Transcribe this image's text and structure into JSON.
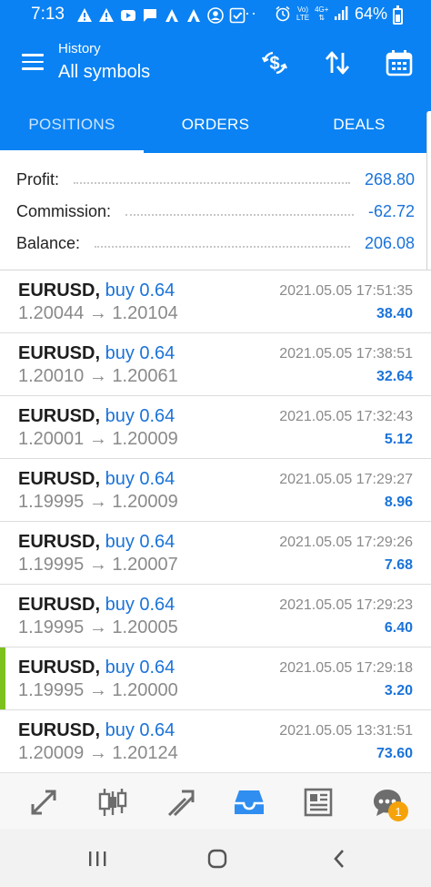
{
  "status_bar": {
    "time": "7:13",
    "dots": "···",
    "network_top": "Vo)",
    "network_bottom": "LTE",
    "network2_top": "4G+",
    "battery": "64%"
  },
  "app_bar": {
    "subtitle": "History",
    "title": "All symbols"
  },
  "tabs": [
    {
      "label": "POSITIONS",
      "active": true
    },
    {
      "label": "ORDERS",
      "active": false
    },
    {
      "label": "DEALS",
      "active": false
    }
  ],
  "summary": {
    "profit_label": "Profit:",
    "profit_value": "268.80",
    "commission_label": "Commission:",
    "commission_value": "-62.72",
    "balance_label": "Balance:",
    "balance_value": "206.08"
  },
  "deals": [
    {
      "symbol": "EURUSD,",
      "type": "buy 0.64",
      "prices": "1.20044 → 1.20104",
      "time": "2021.05.05 17:51:35",
      "profit": "38.40",
      "marked": false
    },
    {
      "symbol": "EURUSD,",
      "type": "buy 0.64",
      "prices": "1.20010 → 1.20061",
      "time": "2021.05.05 17:38:51",
      "profit": "32.64",
      "marked": false
    },
    {
      "symbol": "EURUSD,",
      "type": "buy 0.64",
      "prices": "1.20001 → 1.20009",
      "time": "2021.05.05 17:32:43",
      "profit": "5.12",
      "marked": false
    },
    {
      "symbol": "EURUSD,",
      "type": "buy 0.64",
      "prices": "1.19995 → 1.20009",
      "time": "2021.05.05 17:29:27",
      "profit": "8.96",
      "marked": false
    },
    {
      "symbol": "EURUSD,",
      "type": "buy 0.64",
      "prices": "1.19995 → 1.20007",
      "time": "2021.05.05 17:29:26",
      "profit": "7.68",
      "marked": false
    },
    {
      "symbol": "EURUSD,",
      "type": "buy 0.64",
      "prices": "1.19995 → 1.20005",
      "time": "2021.05.05 17:29:23",
      "profit": "6.40",
      "marked": false
    },
    {
      "symbol": "EURUSD,",
      "type": "buy 0.64",
      "prices": "1.19995 → 1.20000",
      "time": "2021.05.05 17:29:18",
      "profit": "3.20",
      "marked": true
    },
    {
      "symbol": "EURUSD,",
      "type": "buy 0.64",
      "prices": "1.20009 → 1.20124",
      "time": "2021.05.05 13:31:51",
      "profit": "73.60",
      "marked": false
    }
  ],
  "toolbar": {
    "chat_badge": "1",
    "items": [
      "quotes-icon",
      "chart-icon",
      "trade-icon",
      "history-icon",
      "news-icon",
      "chat-icon"
    ]
  },
  "colors": {
    "primary": "#0a82f3",
    "value_blue": "#1a73d9",
    "active_marker": "#7dc11f",
    "badge": "#f5a30b"
  }
}
